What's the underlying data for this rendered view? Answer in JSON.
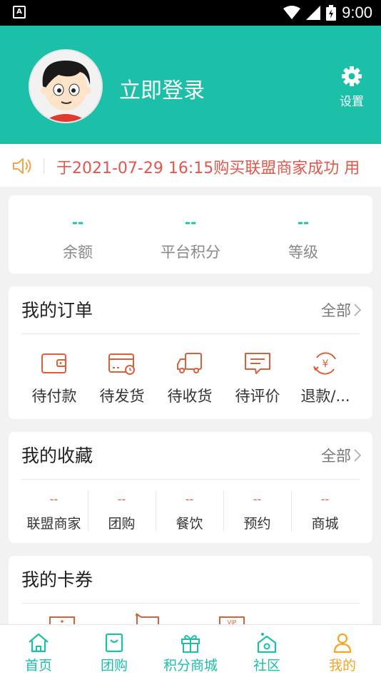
{
  "status_bar": {
    "time": "9:00",
    "left_icon": "A"
  },
  "header": {
    "login_text": "立即登录",
    "settings_label": "设置"
  },
  "marquee": {
    "text": "于2021-07-29 16:15购买联盟商家成功  用"
  },
  "stats": [
    {
      "value": "--",
      "label": "余额"
    },
    {
      "value": "--",
      "label": "平台积分"
    },
    {
      "value": "--",
      "label": "等级"
    }
  ],
  "orders": {
    "title": "我的订单",
    "all_label": "全部",
    "items": [
      {
        "label": "待付款",
        "icon": "wallet-icon"
      },
      {
        "label": "待发货",
        "icon": "card-clock-icon"
      },
      {
        "label": "待收货",
        "icon": "truck-icon"
      },
      {
        "label": "待评价",
        "icon": "comment-icon"
      },
      {
        "label": "退款/...",
        "icon": "refund-yen-icon"
      }
    ]
  },
  "favorites": {
    "title": "我的收藏",
    "all_label": "全部",
    "items": [
      {
        "value": "--",
        "label": "联盟商家"
      },
      {
        "value": "--",
        "label": "团购"
      },
      {
        "value": "--",
        "label": "餐饮"
      },
      {
        "value": "--",
        "label": "预约"
      },
      {
        "value": "--",
        "label": "商城"
      }
    ]
  },
  "coupons": {
    "title": "我的卡券"
  },
  "bottom_nav": [
    {
      "label": "首页",
      "icon": "home-icon"
    },
    {
      "label": "团购",
      "icon": "bag-icon"
    },
    {
      "label": "积分商城",
      "icon": "gift-icon"
    },
    {
      "label": "社区",
      "icon": "community-icon"
    },
    {
      "label": "我的",
      "icon": "user-icon",
      "active": true
    }
  ],
  "colors": {
    "primary": "#1cbfa8",
    "accent": "#e2574c",
    "active_tab": "#f5a623",
    "order_icon": "#d9603b"
  }
}
